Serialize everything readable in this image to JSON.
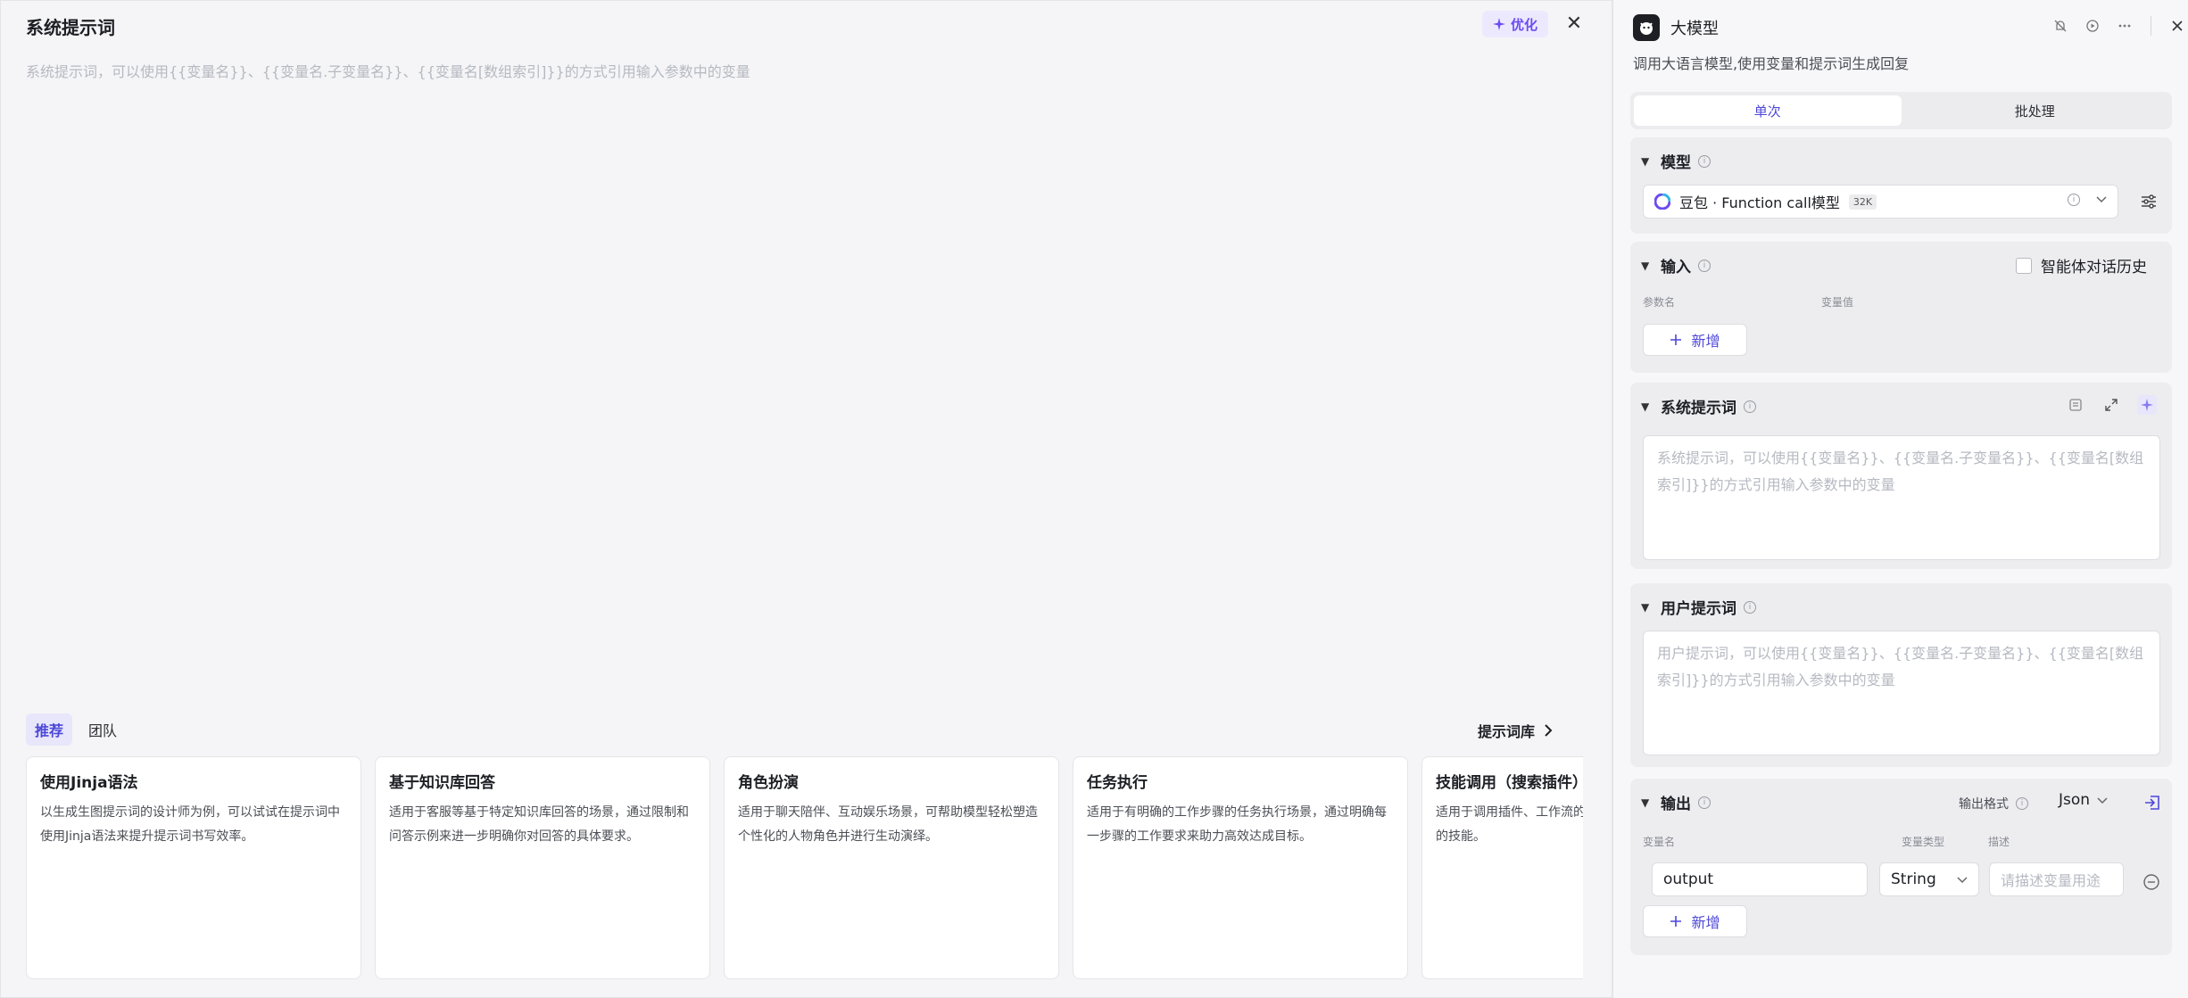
{
  "left_panel": {
    "title": "系统提示词",
    "optimize_label": "优化",
    "placeholder": "系统提示词，可以使用{{变量名}}、{{变量名.子变量名}}、{{变量名[数组索引]}}的方式引用输入参数中的变量",
    "tabs": [
      {
        "label": "推荐",
        "active": true
      },
      {
        "label": "团队",
        "active": false
      }
    ],
    "library_label": "提示词库",
    "cards": [
      {
        "title": "使用Jinja语法",
        "desc": "以生成生图提示词的设计师为例，可以试试在提示词中使用Jinja语法来提升提示词书写效率。"
      },
      {
        "title": "基于知识库回答",
        "desc": "适用于客服等基于特定知识库回答的场景，通过限制和问答示例来进一步明确你对回答的具体要求。"
      },
      {
        "title": "角色扮演",
        "desc": "适用于聊天陪伴、互动娱乐场景，可帮助模型轻松塑造个性化的人物角色并进行生动演绎。"
      },
      {
        "title": "任务执行",
        "desc": "适用于有明确的工作步骤的任务执行场景，通过明确每一步骤的工作要求来助力高效达成目标。"
      },
      {
        "title": "技能调用（搜索插件）",
        "desc": "适用于调用插件、工作流的场景，使用时将提示词需要的技能。"
      }
    ]
  },
  "right_panel": {
    "title": "大模型",
    "description": "调用大语言模型,使用变量和提示词生成回复",
    "segments": [
      {
        "label": "单次",
        "active": true
      },
      {
        "label": "批处理",
        "active": false
      }
    ],
    "model_section": {
      "title": "模型",
      "model_name": "豆包 · Function call模型",
      "context_badge": "32K"
    },
    "input_section": {
      "title": "输入",
      "history_label": "智能体对话历史",
      "col_param": "参数名",
      "col_value": "变量值",
      "add_label": "新增"
    },
    "system_prompt_section": {
      "title": "系统提示词",
      "placeholder": "系统提示词，可以使用{{变量名}}、{{变量名.子变量名}}、{{变量名[数组索引]}}的方式引用输入参数中的变量"
    },
    "user_prompt_section": {
      "title": "用户提示词",
      "placeholder": "用户提示词，可以使用{{变量名}}、{{变量名.子变量名}}、{{变量名[数组索引]}}的方式引用输入参数中的变量"
    },
    "output_section": {
      "title": "输出",
      "format_label": "输出格式",
      "format_value": "Json",
      "col_name": "变量名",
      "col_type": "变量类型",
      "col_desc": "描述",
      "var_name": "output",
      "var_type": "String",
      "desc_placeholder": "请描述变量用途",
      "add_label": "新增"
    }
  },
  "colors": {
    "accent": "#4d47d8",
    "optimize_bg": "#ece9ff",
    "optimize_text": "#6c4bf0"
  }
}
